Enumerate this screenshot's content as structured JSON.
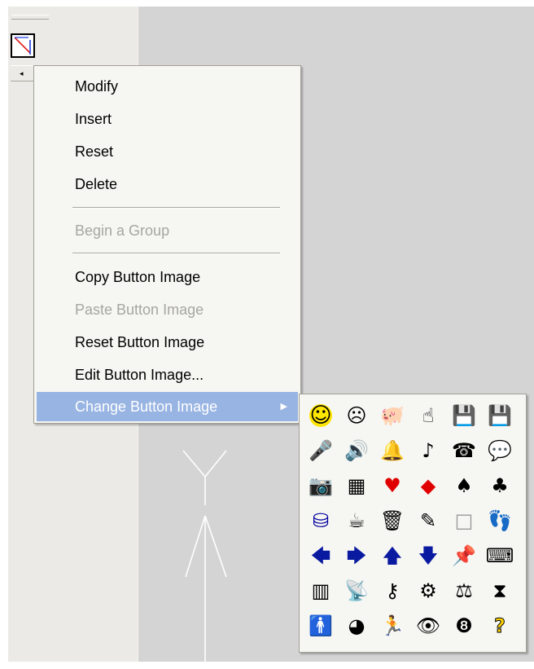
{
  "context_menu": {
    "items": [
      {
        "label": "Modify",
        "enabled": true
      },
      {
        "label": "Insert",
        "enabled": true
      },
      {
        "label": "Reset",
        "enabled": true
      },
      {
        "label": "Delete",
        "enabled": true
      },
      {
        "label": "Begin a Group",
        "enabled": false
      },
      {
        "label": "Copy Button Image",
        "enabled": true
      },
      {
        "label": "Paste Button Image",
        "enabled": false
      },
      {
        "label": "Reset Button Image",
        "enabled": true
      },
      {
        "label": "Edit Button Image...",
        "enabled": true
      },
      {
        "label": "Change Button Image",
        "enabled": true,
        "highlighted": true,
        "has_submenu": true
      }
    ]
  },
  "colors": {
    "menu_bg": "#f6f6f2",
    "highlight": "#98b4e2",
    "disabled_text": "#a7a6a0",
    "toolbar_bg": "#ebeae6",
    "canvas_bg": "#d4d4d4"
  },
  "button_images": [
    [
      "smiley-icon",
      "frown-icon",
      "piggy-bank-icon",
      "hand-pointing-up-icon",
      "save-up-icon",
      "save-down-icon"
    ],
    [
      "microphone-icon",
      "speaker-icon",
      "bell-icon",
      "music-note-icon",
      "telephone-icon",
      "speech-bubble-icon"
    ],
    [
      "camera-icon",
      "calculator-icon",
      "heart-icon",
      "diamond-icon",
      "spade-icon",
      "club-icon"
    ],
    [
      "paint-bucket-icon",
      "mug-icon",
      "trash-can-icon",
      "pencil-icon",
      "blank-square-icon",
      "footprints-icon"
    ],
    [
      "arrow-left-icon",
      "arrow-right-icon",
      "arrow-up-icon",
      "arrow-down-icon",
      "pushpin-icon",
      "keyboard-icon"
    ],
    [
      "book-icon",
      "radio-wave-icon",
      "key-icon",
      "gears-icon",
      "scales-icon",
      "hourglass-icon"
    ],
    [
      "person-icon",
      "head-icon",
      "running-person-icon",
      "eye-icon",
      "eight-ball-icon",
      "question-mark-icon"
    ]
  ]
}
